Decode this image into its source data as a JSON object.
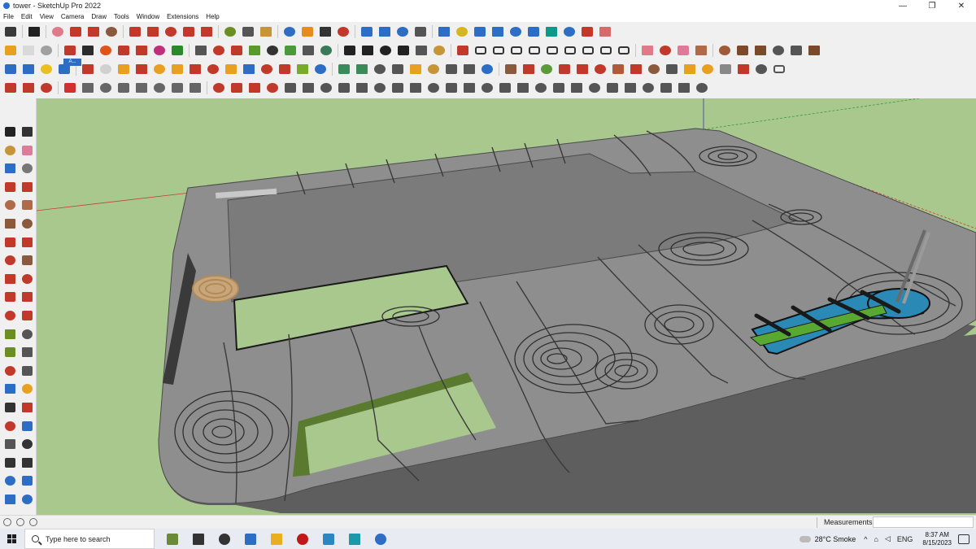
{
  "window": {
    "title": "tower - SketchUp Pro 2022",
    "minimize": "—",
    "restore": "❐",
    "close": "✕"
  },
  "menu": [
    "File",
    "Edit",
    "View",
    "Camera",
    "Draw",
    "Tools",
    "Window",
    "Extensions",
    "Help"
  ],
  "toolbar": {
    "row1": [
      {
        "name": "zoom-window-icon",
        "color": "#3a3a3a"
      },
      {
        "name": "select-icon",
        "color": "#222222"
      },
      {
        "name": "eraser-icon",
        "color": "#e07a8a"
      },
      {
        "name": "pencil-icon",
        "color": "#c0392b"
      },
      {
        "name": "arc-icon",
        "color": "#c0392b"
      },
      {
        "name": "rectangle-icon",
        "color": "#8b5a3c"
      },
      {
        "name": "push-pull-icon",
        "color": "#c0392b"
      },
      {
        "name": "follow-me-icon",
        "color": "#c0392b"
      },
      {
        "name": "move-icon",
        "color": "#c0392b"
      },
      {
        "name": "rotate-icon",
        "color": "#c0392b"
      },
      {
        "name": "scale-icon",
        "color": "#c0392b"
      },
      {
        "name": "tape-measure-icon",
        "color": "#6b8e23"
      },
      {
        "name": "text-icon",
        "color": "#555555"
      },
      {
        "name": "paint-bucket-icon",
        "color": "#c6953a"
      },
      {
        "name": "orbit-icon",
        "color": "#2e6dc4"
      },
      {
        "name": "pan-icon",
        "color": "#e58c20"
      },
      {
        "name": "zoom-icon",
        "color": "#333333"
      },
      {
        "name": "zoom-extents-icon",
        "color": "#c0392b"
      },
      {
        "name": "warehouse-icon",
        "color": "#2e6dc4"
      },
      {
        "name": "extension-warehouse-icon",
        "color": "#2e6dc4"
      },
      {
        "name": "layers-icon",
        "color": "#2e6dc4"
      },
      {
        "name": "user-icon",
        "color": "#555555"
      },
      {
        "name": "arrow-tool-icon",
        "color": "#2e6dc4"
      },
      {
        "name": "flip-icon",
        "color": "#d6b620"
      },
      {
        "name": "axes-icon",
        "color": "#2e6dc4"
      },
      {
        "name": "align-icon",
        "color": "#2e6dc4"
      },
      {
        "name": "mirror-icon",
        "color": "#2e6dc4"
      },
      {
        "name": "connect-icon",
        "color": "#2e6dc4"
      },
      {
        "name": "triangle-icon",
        "color": "#0a9a8a"
      },
      {
        "name": "undo-icon",
        "color": "#2e6dc4"
      },
      {
        "name": "redo-icon",
        "color": "#c0392b"
      },
      {
        "name": "hand-icon",
        "color": "#d46a6a"
      }
    ],
    "row2": [
      {
        "name": "cube-orange-icon",
        "color": "#e8a020"
      },
      {
        "name": "cube-white-icon",
        "color": "#d9d9d9"
      },
      {
        "name": "cube-grey-icon",
        "color": "#a0a0a0"
      },
      {
        "name": "solid-red-icon",
        "color": "#c0392b"
      },
      {
        "name": "solid-black-icon",
        "color": "#2b2b2b"
      },
      {
        "name": "solid-orange-icon",
        "color": "#e0541a"
      },
      {
        "name": "solid-red2-icon",
        "color": "#c0392b"
      },
      {
        "name": "solid-red3-icon",
        "color": "#c0392b"
      },
      {
        "name": "solid-magenta-icon",
        "color": "#c0307a"
      },
      {
        "name": "solid-green-icon",
        "color": "#2a8a2a"
      },
      {
        "name": "curve-icon",
        "color": "#555555"
      },
      {
        "name": "line-dash-red-icon",
        "color": "#c0392b"
      },
      {
        "name": "plus-red-icon",
        "color": "#c0392b"
      },
      {
        "name": "plus-green-icon",
        "color": "#5a9a2a"
      },
      {
        "name": "crosshair-icon",
        "color": "#333333"
      },
      {
        "name": "cube-green-icon",
        "color": "#4a9a3a"
      },
      {
        "name": "book-icon",
        "color": "#555555"
      },
      {
        "name": "pyramid-icon",
        "color": "#3a7a5a"
      },
      {
        "name": "house-icon",
        "color": "#222222"
      },
      {
        "name": "house2-icon",
        "color": "#222222"
      },
      {
        "name": "house3-icon",
        "color": "#222222"
      },
      {
        "name": "house4-icon",
        "color": "#222222"
      },
      {
        "name": "fx-icon",
        "color": "#555555"
      },
      {
        "name": "lasso-icon",
        "color": "#c6953a"
      },
      {
        "name": "pen-red-icon",
        "color": "#c0392b"
      },
      {
        "name": "shape-outline-icon",
        "color": "#333333"
      },
      {
        "name": "shape-outline2-icon",
        "color": "#333333"
      },
      {
        "name": "shape-outline3-icon",
        "color": "#333333"
      },
      {
        "name": "hexagon-icon",
        "color": "#333333"
      },
      {
        "name": "ellipse-icon",
        "color": "#333333"
      },
      {
        "name": "parallelogram-icon",
        "color": "#333333"
      },
      {
        "name": "ring-icon",
        "color": "#333333"
      },
      {
        "name": "shape-outline4-icon",
        "color": "#333333"
      },
      {
        "name": "ring2-icon",
        "color": "#333333"
      },
      {
        "name": "eraser2-icon",
        "color": "#e07a8a"
      },
      {
        "name": "pencil-red-icon",
        "color": "#c0392b"
      },
      {
        "name": "eraser-pink-icon",
        "color": "#e07a9a"
      },
      {
        "name": "wood-block-icon",
        "color": "#b06a4a"
      },
      {
        "name": "wood-block2-icon",
        "color": "#a05a3a"
      },
      {
        "name": "roof-icon",
        "color": "#7a4a2a"
      },
      {
        "name": "roof2-icon",
        "color": "#7a4a2a"
      },
      {
        "name": "stamp-icon",
        "color": "#555555"
      },
      {
        "name": "stamp2-icon",
        "color": "#555555"
      },
      {
        "name": "plane-icon",
        "color": "#7a4a2a"
      }
    ],
    "row3": [
      {
        "name": "box-blue-icon",
        "color": "#2e6dc4"
      },
      {
        "name": "box-blue2-icon",
        "color": "#2e6dc4"
      },
      {
        "name": "box-yellow-icon",
        "color": "#e8c020"
      },
      {
        "name": "tooltip-icon",
        "color": "#2e6dc4"
      },
      {
        "name": "arrow-red-icon",
        "color": "#c0392b"
      },
      {
        "name": "box-grey-icon",
        "color": "#d0d0d0"
      },
      {
        "name": "rotate-orange-icon",
        "color": "#e8a020"
      },
      {
        "name": "square-red-icon",
        "color": "#c0392b"
      },
      {
        "name": "box-orange-icon",
        "color": "#e8a020"
      },
      {
        "name": "box-orange2-icon",
        "color": "#e8a020"
      },
      {
        "name": "box-red-icon",
        "color": "#c0392b"
      },
      {
        "name": "box-red2-icon",
        "color": "#c0392b"
      },
      {
        "name": "box-orange3-icon",
        "color": "#e8a020"
      },
      {
        "name": "dots-blue-icon",
        "color": "#2e6dc4"
      },
      {
        "name": "dots-red-icon",
        "color": "#c0392b"
      },
      {
        "name": "plus-red2-icon",
        "color": "#c0392b"
      },
      {
        "name": "plus-green2-icon",
        "color": "#7aaa2a"
      },
      {
        "name": "cross-blue-icon",
        "color": "#2e6dc4"
      },
      {
        "name": "cone-icon",
        "color": "#3a8a5a"
      },
      {
        "name": "cone2-icon",
        "color": "#3a8a5a"
      },
      {
        "name": "shell-icon",
        "color": "#555555"
      },
      {
        "name": "spiral-icon",
        "color": "#555555"
      },
      {
        "name": "warning-icon",
        "color": "#e8a020"
      },
      {
        "name": "knot-icon",
        "color": "#c6953a"
      },
      {
        "name": "loop-icon",
        "color": "#555555"
      },
      {
        "name": "loop2-icon",
        "color": "#555555"
      },
      {
        "name": "star-blue-icon",
        "color": "#2e6dc4"
      },
      {
        "name": "cup-icon",
        "color": "#8b5a3c"
      },
      {
        "name": "magnet-icon",
        "color": "#c0392b"
      },
      {
        "name": "tiles-green-icon",
        "color": "#5a9a3a"
      },
      {
        "name": "tiles-red-icon",
        "color": "#c0392b"
      },
      {
        "name": "chain-icon",
        "color": "#c0392b"
      },
      {
        "name": "chain2-icon",
        "color": "#c0392b"
      },
      {
        "name": "box-icon",
        "color": "#b05a3a"
      },
      {
        "name": "box2-icon",
        "color": "#c0392b"
      },
      {
        "name": "box3-icon",
        "color": "#8b5a3c"
      },
      {
        "name": "fence-icon",
        "color": "#555555"
      },
      {
        "name": "grid-orange-icon",
        "color": "#e8a020"
      },
      {
        "name": "grid-orange2-icon",
        "color": "#e8a020"
      },
      {
        "name": "grid-grey-icon",
        "color": "#888888"
      },
      {
        "name": "arrows-red-icon",
        "color": "#c0392b"
      },
      {
        "name": "dots-circle-icon",
        "color": "#555555"
      },
      {
        "name": "rect-outline-icon",
        "color": "#555555"
      }
    ],
    "row4": [
      {
        "name": "line-red-icon",
        "color": "#c0392b"
      },
      {
        "name": "dots-line-icon",
        "color": "#c0392b"
      },
      {
        "name": "box-red3-icon",
        "color": "#c0392b"
      },
      {
        "name": "ruby-icon",
        "color": "#d03030"
      },
      {
        "name": "book2-icon",
        "color": "#666666"
      },
      {
        "name": "book3-icon",
        "color": "#666666"
      },
      {
        "name": "book4-icon",
        "color": "#666666"
      },
      {
        "name": "book5-icon",
        "color": "#666666"
      },
      {
        "name": "book6-icon",
        "color": "#666666"
      },
      {
        "name": "book7-icon",
        "color": "#666666"
      },
      {
        "name": "book8-icon",
        "color": "#666666"
      },
      {
        "name": "angle-red-icon",
        "color": "#c0392b"
      },
      {
        "name": "angle2-red-icon",
        "color": "#c0392b"
      },
      {
        "name": "angle3-red-icon",
        "color": "#c0392b"
      },
      {
        "name": "curve-red-icon",
        "color": "#c0392b"
      },
      {
        "name": "tent-icon",
        "color": "#555555"
      },
      {
        "name": "pattern-icon",
        "color": "#555555"
      },
      {
        "name": "pattern2-icon",
        "color": "#555555"
      },
      {
        "name": "pattern3-icon",
        "color": "#555555"
      },
      {
        "name": "pattern4-icon",
        "color": "#555555"
      },
      {
        "name": "pattern5-icon",
        "color": "#555555"
      },
      {
        "name": "pattern6-icon",
        "color": "#555555"
      },
      {
        "name": "pattern7-icon",
        "color": "#555555"
      },
      {
        "name": "pattern8-icon",
        "color": "#555555"
      },
      {
        "name": "pattern9-icon",
        "color": "#555555"
      },
      {
        "name": "pattern10-icon",
        "color": "#555555"
      },
      {
        "name": "pattern11-icon",
        "color": "#555555"
      },
      {
        "name": "pattern12-icon",
        "color": "#555555"
      },
      {
        "name": "pattern13-icon",
        "color": "#555555"
      },
      {
        "name": "pattern14-icon",
        "color": "#555555"
      },
      {
        "name": "pattern15-icon",
        "color": "#555555"
      },
      {
        "name": "pattern16-icon",
        "color": "#555555"
      },
      {
        "name": "pattern17-icon",
        "color": "#555555"
      },
      {
        "name": "pattern18-icon",
        "color": "#555555"
      },
      {
        "name": "pattern19-icon",
        "color": "#555555"
      },
      {
        "name": "pattern20-icon",
        "color": "#555555"
      },
      {
        "name": "pattern21-icon",
        "color": "#555555"
      },
      {
        "name": "pattern22-icon",
        "color": "#555555"
      },
      {
        "name": "pattern23-icon",
        "color": "#555555"
      }
    ],
    "ruby_badge": "A..."
  },
  "left_tools": [
    {
      "name": "select-icon",
      "color": "#222222"
    },
    {
      "name": "make-component-icon",
      "color": "#333333"
    },
    {
      "name": "paint-bucket-icon",
      "color": "#c6953a"
    },
    {
      "name": "eraser-icon",
      "color": "#e07a9a"
    },
    {
      "name": "tag-icon",
      "color": "#2e6dc4"
    },
    {
      "name": "pencil-tool-icon",
      "color": "#777777"
    },
    {
      "name": "line-icon",
      "color": "#c0392b"
    },
    {
      "name": "freehand-icon",
      "color": "#c0392b"
    },
    {
      "name": "rectangle-icon",
      "color": "#b06a4a"
    },
    {
      "name": "rotated-rectangle-icon",
      "color": "#b06a4a"
    },
    {
      "name": "circle-icon",
      "color": "#8b5a3c"
    },
    {
      "name": "polygon-icon",
      "color": "#8b5a3c"
    },
    {
      "name": "arc-icon",
      "color": "#c0392b"
    },
    {
      "name": "arc2-icon",
      "color": "#c0392b"
    },
    {
      "name": "arc3-icon",
      "color": "#c0392b"
    },
    {
      "name": "pie-icon",
      "color": "#8b5a3c"
    },
    {
      "name": "move-icon",
      "color": "#c0392b"
    },
    {
      "name": "push-pull-icon",
      "color": "#c0392b"
    },
    {
      "name": "rotate-icon",
      "color": "#c0392b"
    },
    {
      "name": "follow-me-icon",
      "color": "#c0392b"
    },
    {
      "name": "scale-icon",
      "color": "#c0392b"
    },
    {
      "name": "offset-icon",
      "color": "#c0392b"
    },
    {
      "name": "tape-measure-icon",
      "color": "#6b8e23"
    },
    {
      "name": "dimension-icon",
      "color": "#555555"
    },
    {
      "name": "protractor-icon",
      "color": "#6b8e23"
    },
    {
      "name": "text-icon",
      "color": "#555555"
    },
    {
      "name": "axes-icon",
      "color": "#c0392b"
    },
    {
      "name": "3d-text-icon",
      "color": "#555555"
    },
    {
      "name": "orbit-icon",
      "color": "#2e6dc4"
    },
    {
      "name": "pan-icon",
      "color": "#e8a020"
    },
    {
      "name": "zoom-icon",
      "color": "#333333"
    },
    {
      "name": "zoom-window-icon",
      "color": "#c0392b"
    },
    {
      "name": "zoom-extents-icon",
      "color": "#c0392b"
    },
    {
      "name": "previous-view-icon",
      "color": "#2e6dc4"
    },
    {
      "name": "position-camera-icon",
      "color": "#555555"
    },
    {
      "name": "look-around-icon",
      "color": "#333333"
    },
    {
      "name": "walk-icon",
      "color": "#333333"
    },
    {
      "name": "section-plane-icon",
      "color": "#333333"
    },
    {
      "name": "warehouse-icon",
      "color": "#2e6dc4"
    },
    {
      "name": "extension-icon",
      "color": "#2e6dc4"
    },
    {
      "name": "layers-icon",
      "color": "#2e6dc4"
    },
    {
      "name": "layers2-icon",
      "color": "#2e6dc4"
    }
  ],
  "statusbar": {
    "measurements_label": "Measurements",
    "measurements_value": ""
  },
  "taskbar": {
    "search_placeholder": "Type here to search",
    "apps": [
      {
        "name": "minecraft-app-icon",
        "color": "#6a8a3a"
      },
      {
        "name": "headset-app-icon",
        "color": "#333333"
      },
      {
        "name": "task-view-icon",
        "color": "#333333"
      },
      {
        "name": "calculator-app-icon",
        "color": "#2e6dc4"
      },
      {
        "name": "file-explorer-icon",
        "color": "#e8b020"
      },
      {
        "name": "acrobat-app-icon",
        "color": "#c01818"
      },
      {
        "name": "sketchup-launcher-icon",
        "color": "#2e86c1"
      },
      {
        "name": "edge-browser-icon",
        "color": "#1a9aa8"
      },
      {
        "name": "sketchup-app-icon",
        "color": "#2e6dc4"
      }
    ],
    "weather": "28°C Smoke",
    "language": "ENG",
    "time": "8:37 AM",
    "date": "8/15/2023"
  },
  "scene": {
    "sky_color": "#a9c88d",
    "slab_color": "#8e8e8e",
    "roof_color": "#7a7a7a",
    "grass_color": "#9fc48a",
    "pool_color": "#2a8ab5",
    "turf_color": "#59a832"
  }
}
